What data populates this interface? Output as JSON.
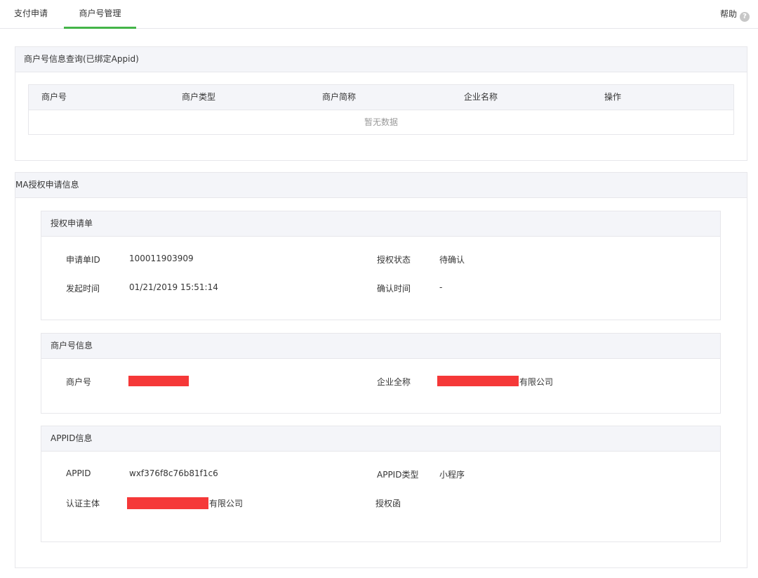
{
  "topbar": {
    "tabs": [
      {
        "label": "支付申请",
        "active": false
      },
      {
        "label": "商户号管理",
        "active": true
      }
    ],
    "help_label": "帮助",
    "help_icon": "?"
  },
  "merchant_query": {
    "title": "商户号信息查询(已绑定Appid)",
    "columns": [
      "商户号",
      "商户类型",
      "商户简称",
      "企业名称",
      "操作"
    ],
    "empty_text": "暂无数据"
  },
  "ma_auth": {
    "title": "MA授权申请信息",
    "auth_form": {
      "title": "授权申请单",
      "fields": [
        {
          "label": "申请单ID",
          "value": "100011903909"
        },
        {
          "label": "授权状态",
          "value": "待确认"
        },
        {
          "label": "发起时间",
          "value": "01/21/2019 15:51:14"
        },
        {
          "label": "确认时间",
          "value": "-"
        }
      ]
    },
    "merchant_info": {
      "title": "商户号信息",
      "merchant_label": "商户号",
      "company_label": "企业全称",
      "company_suffix": "有限公司"
    },
    "appid_info": {
      "title": "APPID信息",
      "appid_label": "APPID",
      "appid_value": "wxf376f8c76b81f1c6",
      "appid_type_label": "APPID类型",
      "appid_type_value": "小程序",
      "subject_label": "认证主体",
      "subject_suffix": "有限公司",
      "letter_label": "授权函"
    }
  },
  "colors": {
    "accent": "#44b549",
    "redaction": "#f53838",
    "panel_header": "#f4f5f9",
    "border": "#e7e7eb"
  }
}
